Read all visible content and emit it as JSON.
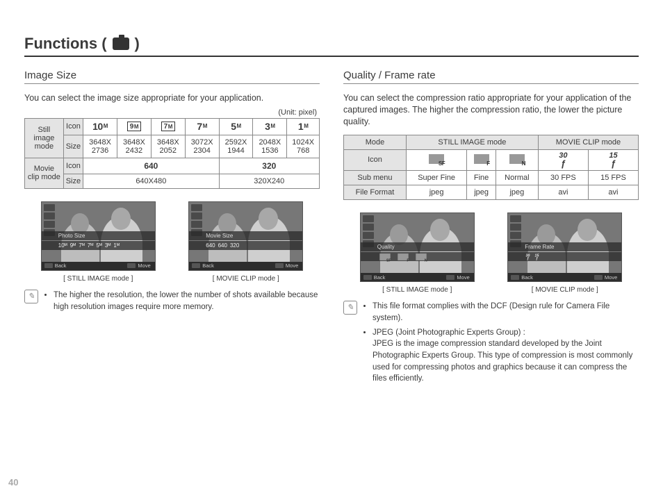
{
  "title_prefix": "Functions (",
  "title_suffix": ")",
  "page_number": "40",
  "left": {
    "heading": "Image Size",
    "intro": "You can select the image size appropriate for your application.",
    "unit": "(Unit: pixel)",
    "table": {
      "still_label": "Still image mode",
      "movie_label": "Movie clip mode",
      "row_icon": "Icon",
      "row_size": "Size",
      "still_icons": [
        "10ᴹ",
        "9ᴹ",
        "7ᴹ",
        "7ᴹ",
        "5ᴹ",
        "3ᴹ",
        "1ᴹ"
      ],
      "still_sizes": [
        "3648X 2736",
        "3648X 2432",
        "3648X 2052",
        "3072X 2304",
        "2592X 1944",
        "2048X 1536",
        "1024X 768"
      ],
      "movie_icons": [
        "640",
        "320"
      ],
      "movie_sizes": [
        "640X480",
        "320X240"
      ]
    },
    "lcd": {
      "cap_still": "[ STILL IMAGE mode ]",
      "cap_movie": "[ MOVIE CLIP mode ]",
      "banner_still": "Photo Size",
      "banner_movie": "Movie Size",
      "row_still": [
        "10ᴹ",
        "9ᴹ",
        "7ᴹ",
        "7ᴹ",
        "5ᴹ",
        "3ᴹ",
        "1ᴹ"
      ],
      "row_movie": [
        "640",
        "640",
        "320"
      ],
      "back": "Back",
      "move": "Move"
    },
    "note": "The higher the resolution, the lower the number of shots available because high resolution images require more memory."
  },
  "right": {
    "heading": "Quality / Frame rate",
    "intro": "You can select the compression ratio appropriate for your application of the captured images. The higher the compression ratio, the lower the picture quality.",
    "table": {
      "h_mode": "Mode",
      "h_still": "STILL IMAGE mode",
      "h_movie": "MOVIE CLIP mode",
      "h_icon": "Icon",
      "h_sub": "Sub menu",
      "h_file": "File Format",
      "sub": [
        "Super Fine",
        "Fine",
        "Normal",
        "30 FPS",
        "15 FPS"
      ],
      "file": [
        "jpeg",
        "jpeg",
        "jpeg",
        "avi",
        "avi"
      ],
      "fps": [
        "30",
        "15"
      ]
    },
    "lcd": {
      "cap_still": "[ STILL IMAGE mode ]",
      "cap_movie": "[ MOVIE CLIP mode ]",
      "banner_still": "Quality",
      "banner_movie": "Frame Rate",
      "back": "Back",
      "move": "Move"
    },
    "notes": [
      "This file format complies with the DCF (Design rule for Camera File system).",
      "JPEG (Joint Photographic Experts Group) :"
    ],
    "note_body": "JPEG is the image compression standard developed by the Joint Photographic Experts Group. This type of compression is most commonly used for compressing photos and graphics because it can compress the files efficiently."
  }
}
